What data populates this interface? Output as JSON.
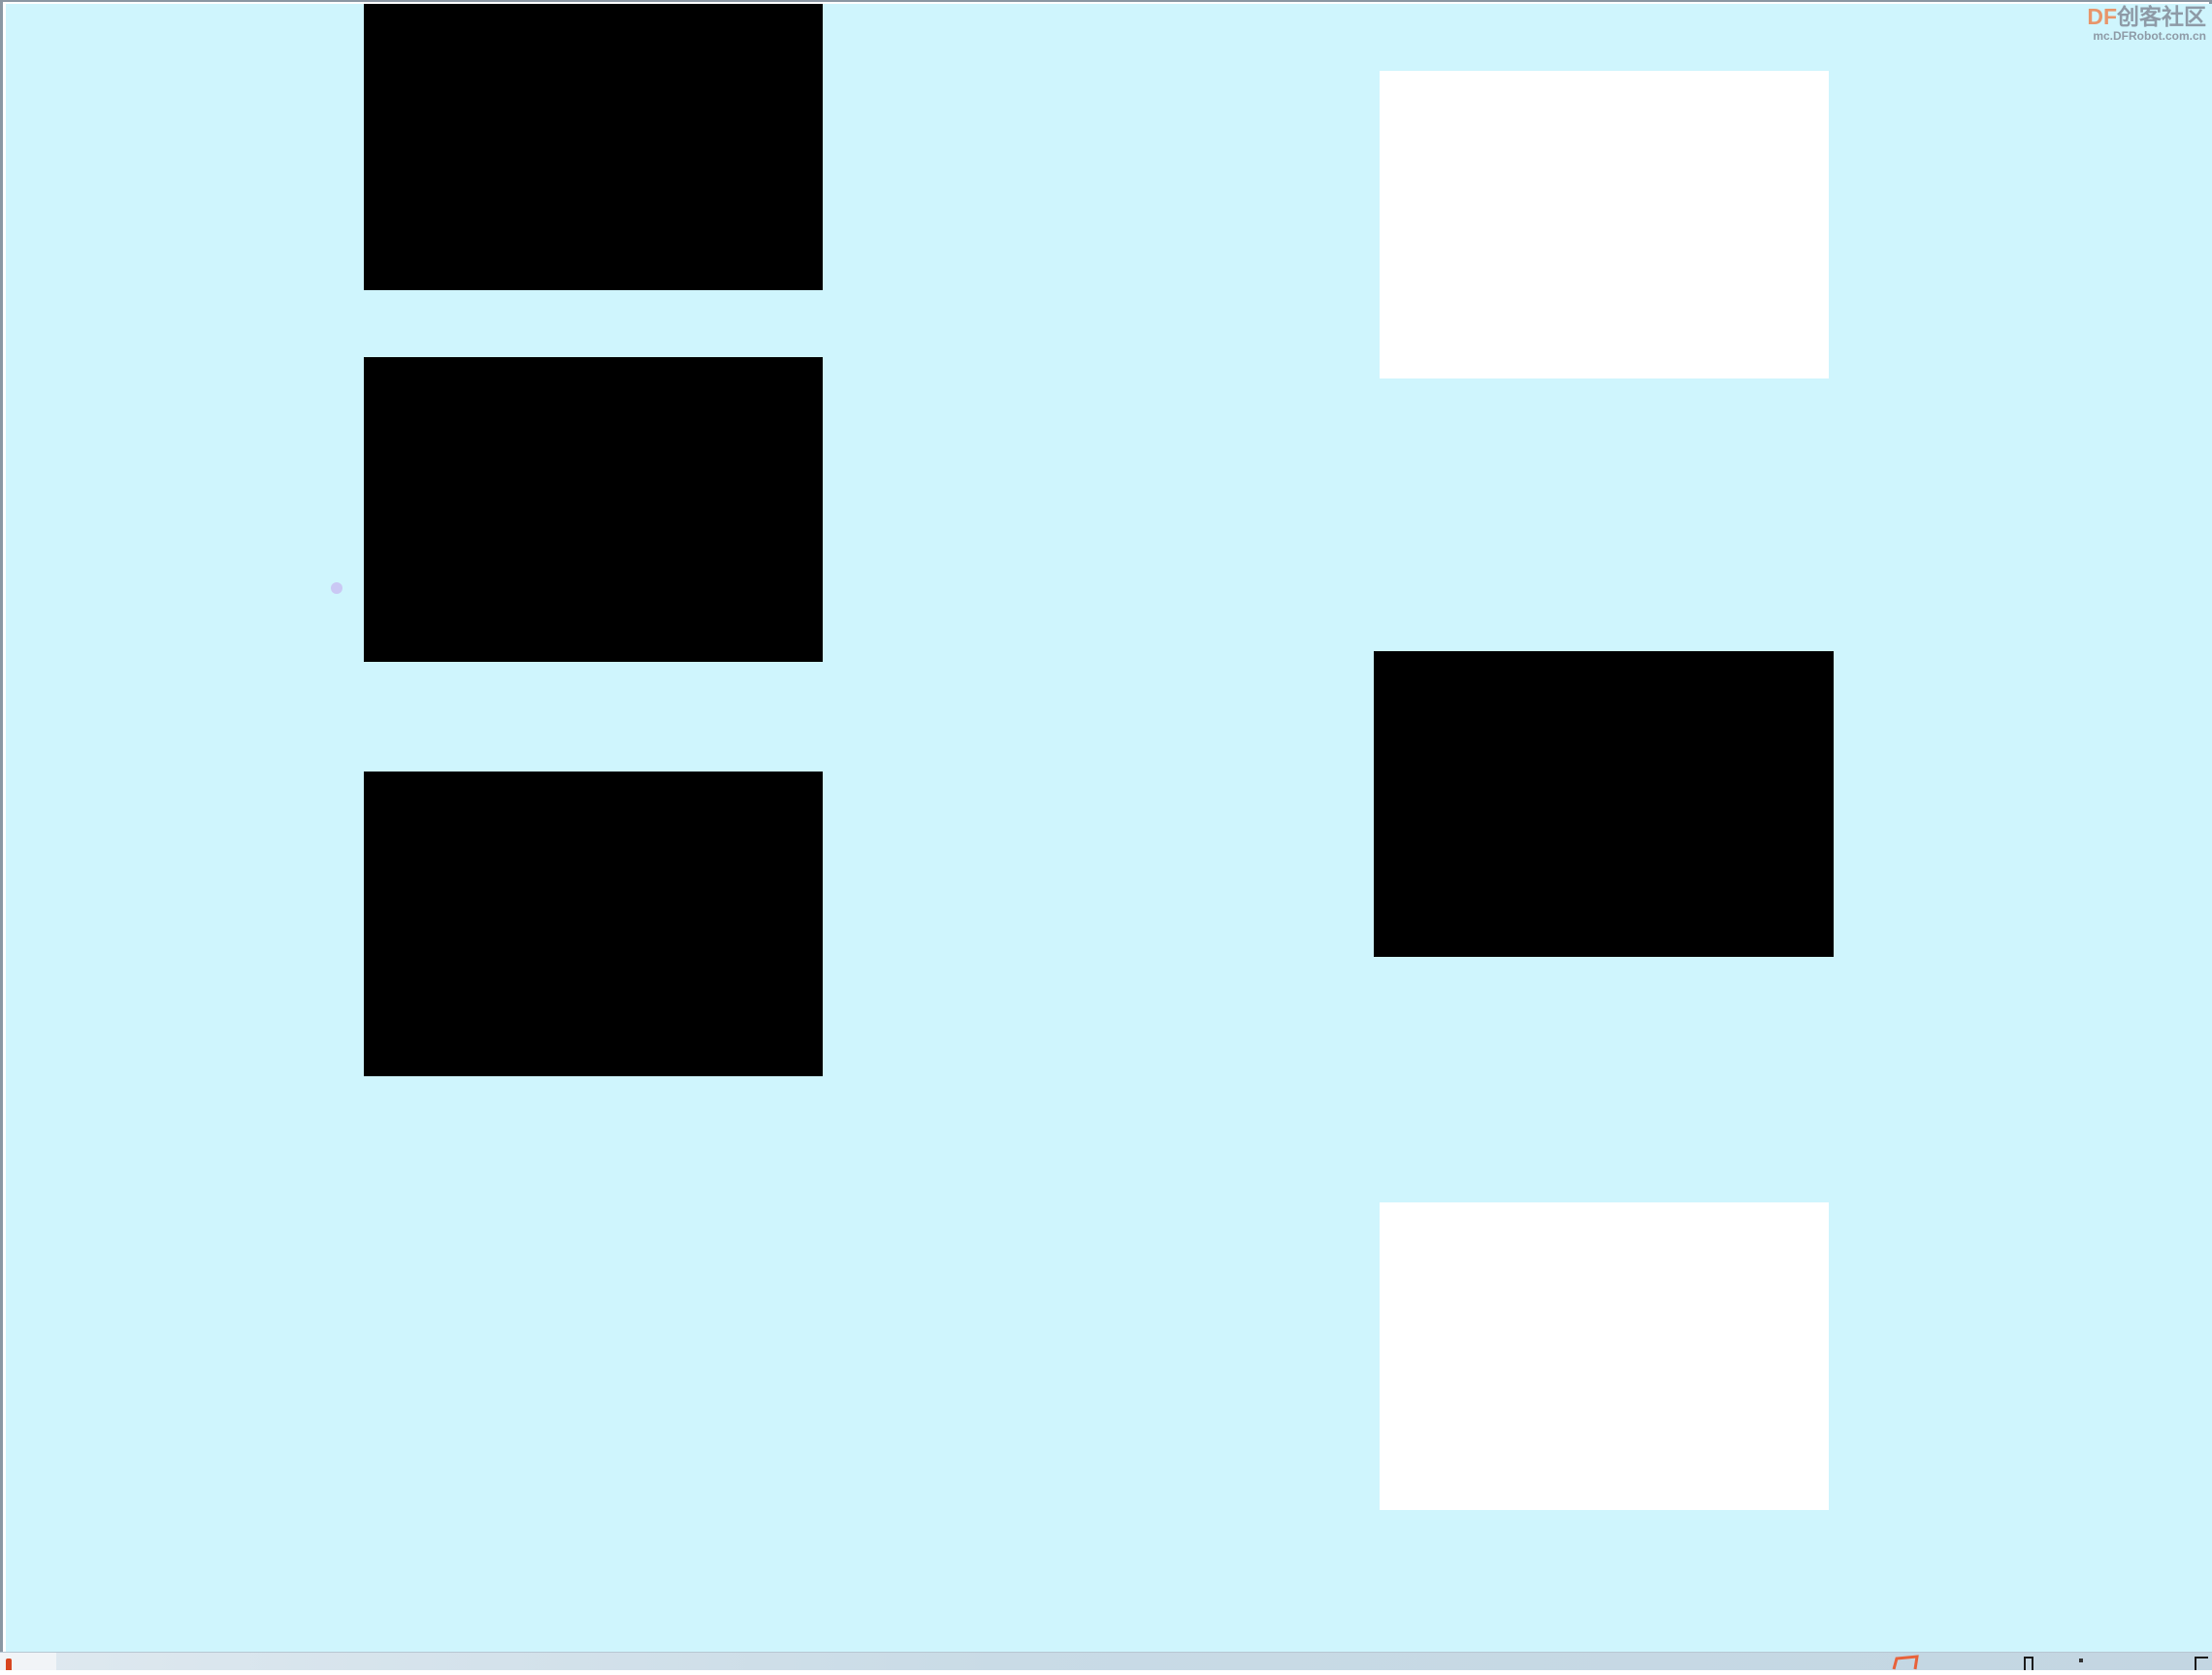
{
  "colors": {
    "background": "#cff5fd",
    "tile_black": "#000000",
    "tile_white": "#ffffff",
    "cursor": "#c9c0f2",
    "taskbar_accent": "#e8623a"
  },
  "board": {
    "left_column": [
      {
        "color": "black"
      },
      {
        "color": "black"
      },
      {
        "color": "black"
      }
    ],
    "right_column": [
      {
        "color": "white"
      },
      {
        "color": "black"
      },
      {
        "color": "white"
      }
    ]
  },
  "watermark": {
    "brand_df": "DF",
    "brand_cn": "创客社区",
    "url": "mc.DFRobot.com.cn"
  },
  "taskbar": {
    "icons": [
      "start-icon",
      "app-icon",
      "tray-icon",
      "tray-dot-icon",
      "show-desktop-icon"
    ]
  }
}
